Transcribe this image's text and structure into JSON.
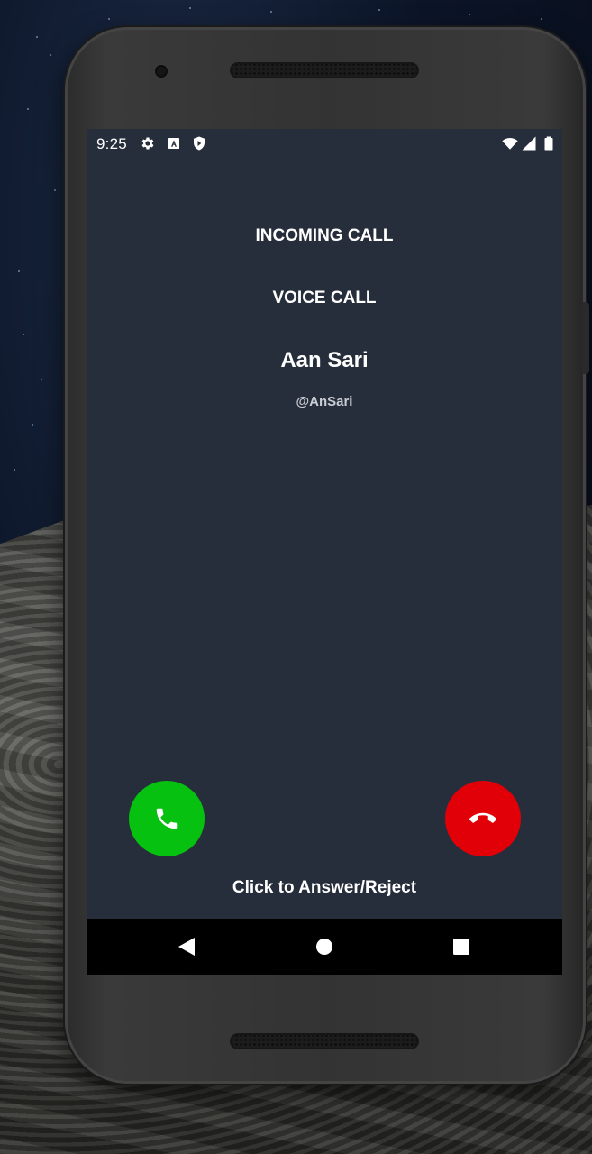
{
  "status_bar": {
    "time": "9:25",
    "left_icons": [
      "gear-icon",
      "a-box-icon",
      "shield-icon"
    ],
    "right_icons": [
      "wifi-icon",
      "signal-icon",
      "battery-icon"
    ]
  },
  "call": {
    "heading": "INCOMING CALL",
    "type": "VOICE CALL",
    "caller_name": "Aan Sari",
    "caller_handle": "@AnSari",
    "hint": "Click to Answer/Reject"
  },
  "buttons": {
    "answer": {
      "icon": "phone-icon",
      "color": "#06c10f"
    },
    "reject": {
      "icon": "phone-hangup-icon",
      "color": "#e10008"
    }
  },
  "nav": {
    "items": [
      "back-icon",
      "home-icon",
      "recents-icon"
    ]
  },
  "colors": {
    "screen_background": "#262d3b",
    "text": "#ffffff",
    "handle_text": "#c8ccd3",
    "nav_background": "#000000"
  }
}
